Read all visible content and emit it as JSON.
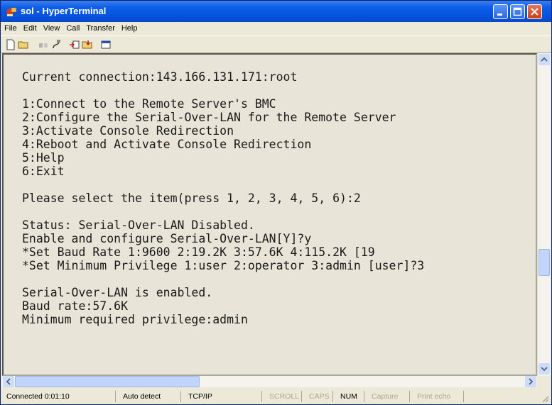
{
  "window": {
    "title": "sol - HyperTerminal"
  },
  "menu": [
    "File",
    "Edit",
    "View",
    "Call",
    "Transfer",
    "Help"
  ],
  "toolbar": {
    "icons": [
      "new-icon",
      "open-icon",
      "disconnect-icon",
      "connect-icon",
      "send-icon",
      "receive-icon",
      "properties-icon"
    ]
  },
  "terminal": {
    "lines": [
      "Current connection:143.166.131.171:root",
      "",
      "1:Connect to the Remote Server's BMC",
      "2:Configure the Serial-Over-LAN for the Remote Server",
      "3:Activate Console Redirection",
      "4:Reboot and Activate Console Redirection",
      "5:Help",
      "6:Exit",
      "",
      "Please select the item(press 1, 2, 3, 4, 5, 6):2",
      "",
      "Status: Serial-Over-LAN Disabled.",
      "Enable and configure Serial-Over-LAN[Y]?y",
      "*Set Baud Rate 1:9600 2:19.2K 3:57.6K 4:115.2K [19",
      "*Set Minimum Privilege 1:user 2:operator 3:admin [user]?3",
      "",
      "Serial-Over-LAN is enabled.",
      "Baud rate:57.6K",
      "Minimum required privilege:admin"
    ]
  },
  "status": {
    "connected": "Connected 0:01:10",
    "detect": "Auto detect",
    "protocol": "TCP/IP",
    "scroll": "SCROLL",
    "caps": "CAPS",
    "num": "NUM",
    "capture": "Capture",
    "print_echo": "Print echo"
  },
  "colors": {
    "titlebar": "#0554e0",
    "terminal_bg": "#e8e4d8",
    "terminal_text": "#1a1a1a"
  }
}
